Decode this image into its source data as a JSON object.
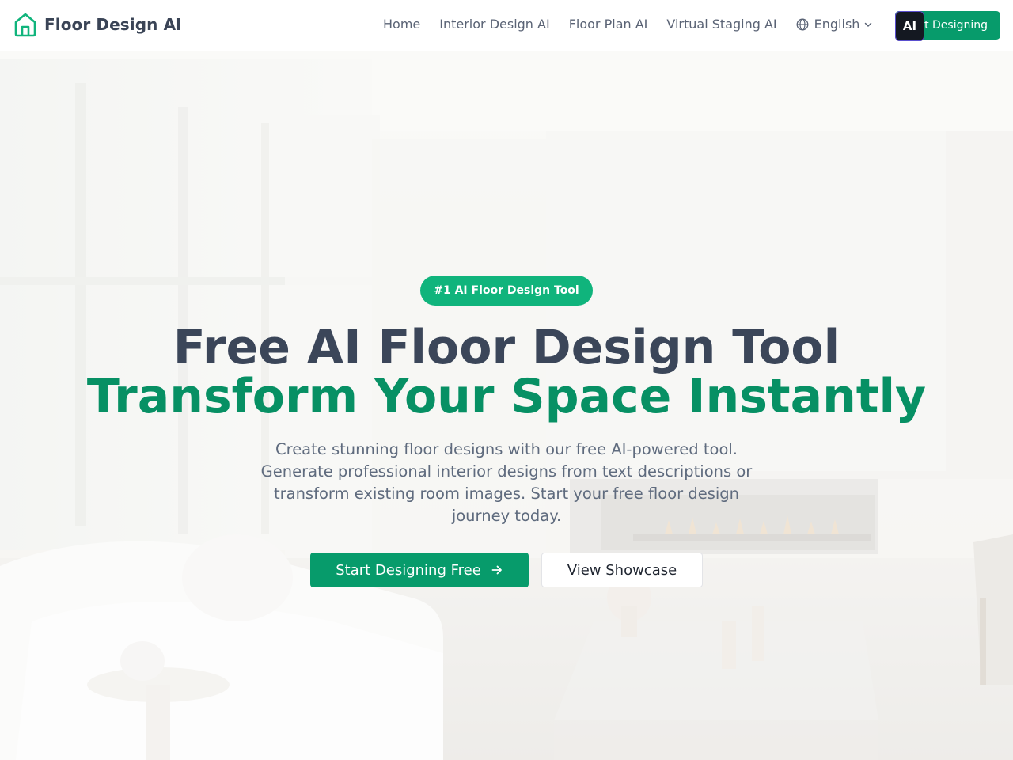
{
  "header": {
    "brand": "Floor Design AI",
    "nav": [
      {
        "label": "Home"
      },
      {
        "label": "Interior Design AI"
      },
      {
        "label": "Floor Plan AI"
      },
      {
        "label": "Virtual Staging AI"
      }
    ],
    "language": "English",
    "cta_label": "Start Designing",
    "extension_badge": "AI"
  },
  "hero": {
    "badge": "#1 AI Floor Design Tool",
    "title_line1": "Free AI Floor Design Tool",
    "title_line2": "Transform Your Space Instantly",
    "description": "Create stunning floor designs with our free AI-powered tool. Generate professional interior designs from text descriptions or transform existing room images. Start your free floor design journey today.",
    "primary_button": "Start Designing Free",
    "secondary_button": "View Showcase"
  },
  "colors": {
    "brand_green": "#079b6b",
    "badge_green": "#10b47c",
    "title_dark": "#3b4659",
    "title_green": "#079064"
  },
  "icons": {
    "logo": "house-icon",
    "language": "globe-icon",
    "dropdown": "chevron-down-icon",
    "arrow": "arrow-right-icon"
  }
}
